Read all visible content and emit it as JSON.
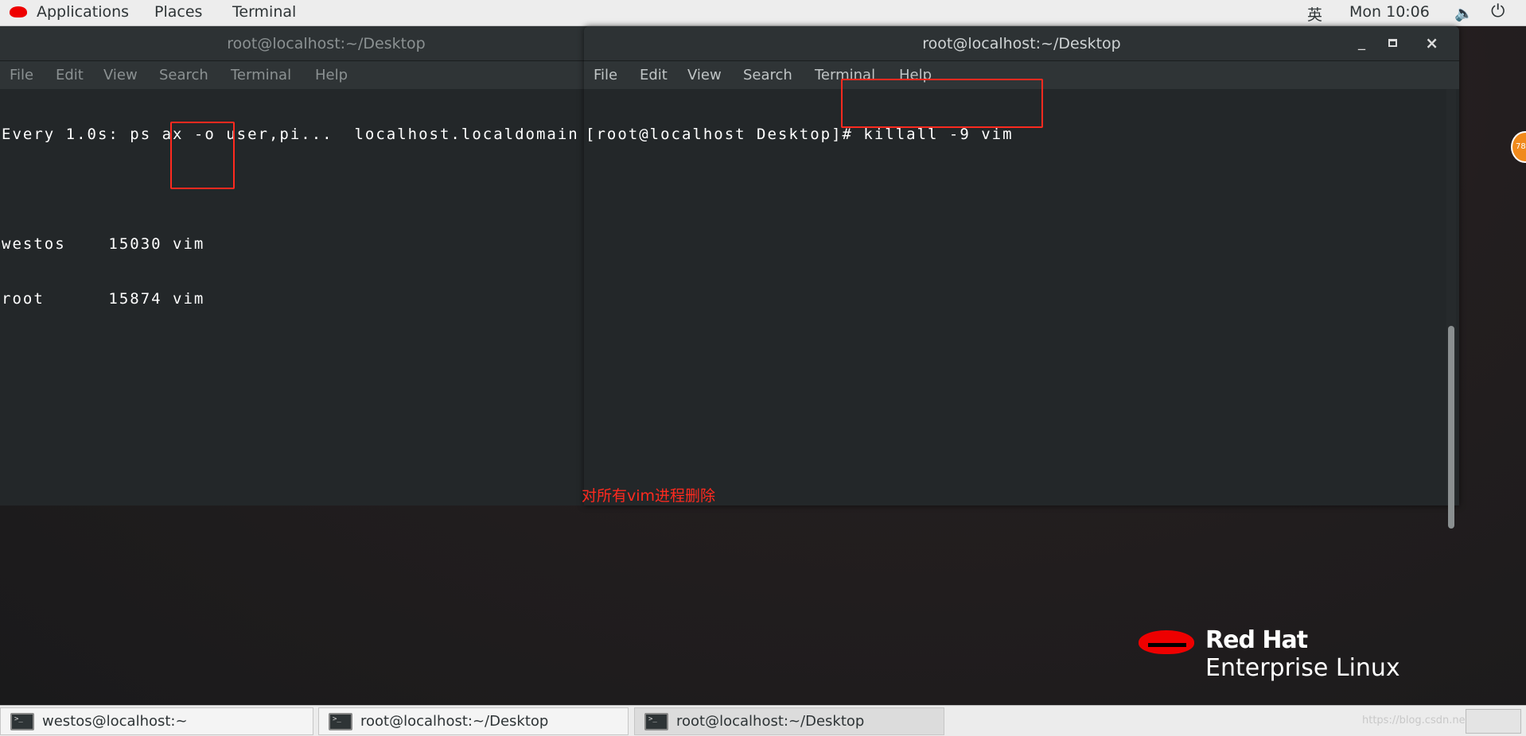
{
  "topbar": {
    "applications": "Applications",
    "places": "Places",
    "terminal": "Terminal",
    "input_method": "英",
    "clock": "Mon 10:06"
  },
  "left_terminal": {
    "title": "root@localhost:~/Desktop",
    "menu": [
      "File",
      "Edit",
      "View",
      "Search",
      "Terminal",
      "Help"
    ],
    "lines": [
      "Every 1.0s: ps ax -o user,pi...  localhost.localdomain",
      "",
      "westos    15030 vim",
      "root      15874 vim"
    ]
  },
  "right_terminal": {
    "title": "root@localhost:~/Desktop",
    "menu": [
      "File",
      "Edit",
      "View",
      "Search",
      "Terminal",
      "Help"
    ],
    "lines": [
      "[root@localhost Desktop]# killall -9 vim"
    ]
  },
  "annotation": "对所有vim进程删除",
  "logo": {
    "line1": "Red Hat",
    "line2": "Enterprise Linux"
  },
  "taskbar": [
    "westos@localhost:~",
    "root@localhost:~/Desktop",
    "root@localhost:~/Desktop"
  ],
  "watermark": "https://blog.csdn.net/...",
  "badge": "78",
  "colors": {
    "annotation": "#ff2a1f",
    "terminal_bg": "#232729",
    "redhat": "#ee0000"
  }
}
